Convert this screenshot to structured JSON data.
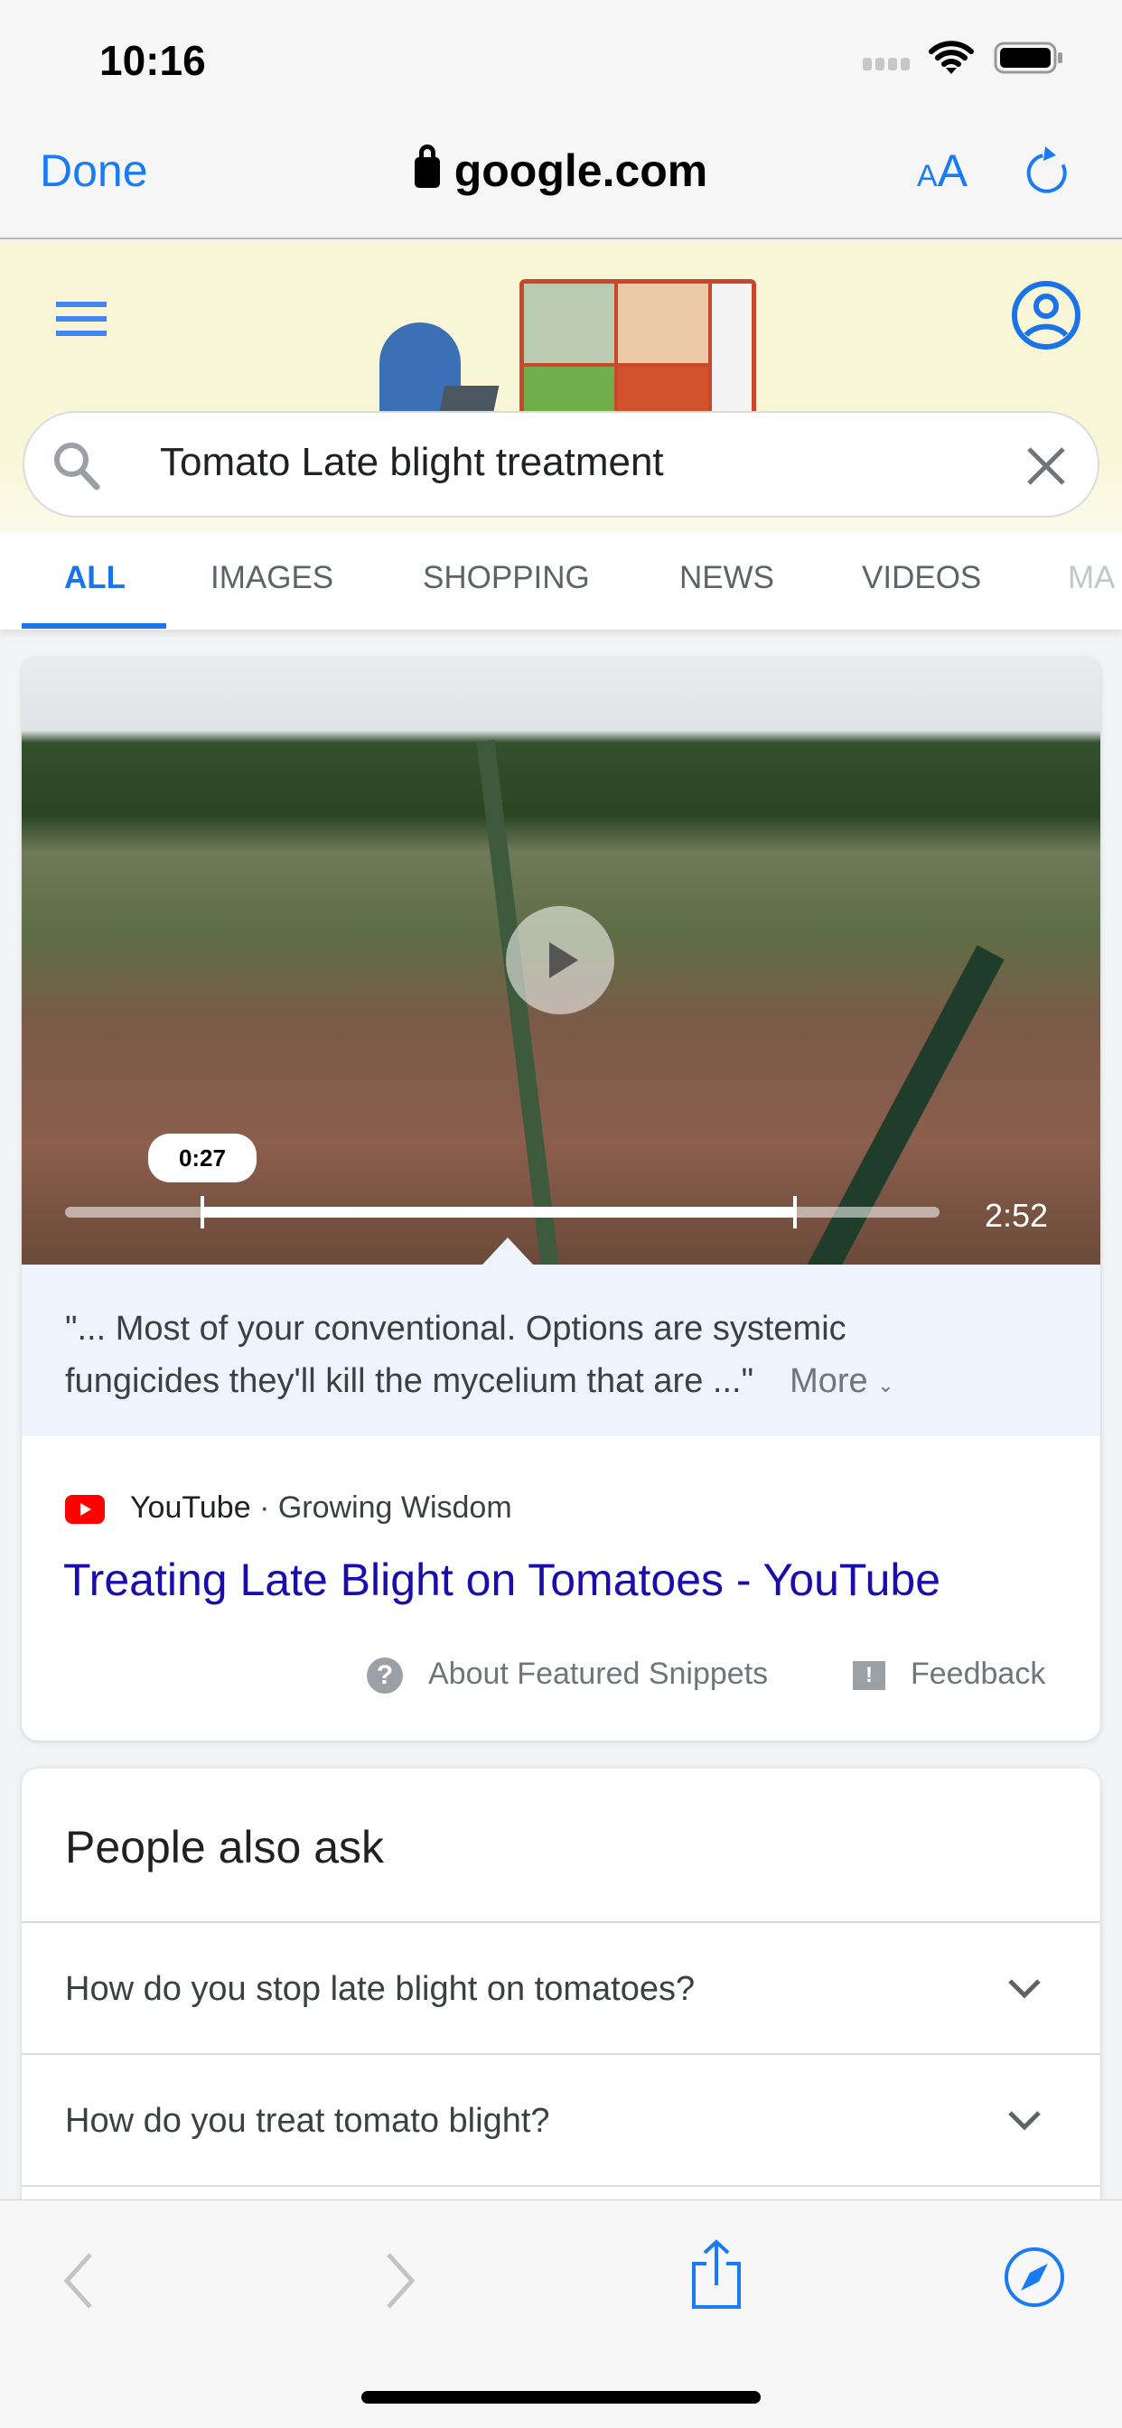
{
  "status_bar": {
    "time": "10:16"
  },
  "browser": {
    "done_label": "Done",
    "url": "google.com",
    "text_size_small": "A",
    "text_size_large": "A"
  },
  "search": {
    "query": "Tomato Late blight treatment"
  },
  "tabs": [
    {
      "label": "ALL",
      "active": true
    },
    {
      "label": "IMAGES"
    },
    {
      "label": "SHOPPING"
    },
    {
      "label": "NEWS"
    },
    {
      "label": "VIDEOS"
    },
    {
      "label": "MA"
    }
  ],
  "featured": {
    "current_time": "0:27",
    "duration": "2:52",
    "progress_start": 0.157,
    "progress_end": 0.835,
    "snippet_line1": "\"... Most of your conventional. Options are systemic",
    "snippet_line2": "fungicides they'll kill the mycelium that are ...\"",
    "more_label": "More",
    "source": "YouTube",
    "channel": "· Growing Wisdom",
    "title": "Treating Late Blight on Tomatoes - YouTube",
    "about_label": "About Featured Snippets",
    "feedback_label": "Feedback"
  },
  "people_also_ask": {
    "title": "People also ask",
    "questions": [
      "How do you stop late blight on tomatoes?",
      "How do you treat tomato blight?"
    ]
  },
  "colors": {
    "accent": "#1a73e8",
    "ios_blue": "#1a7cf5",
    "youtube_red": "#ff0000",
    "link": "#1a0dab"
  }
}
